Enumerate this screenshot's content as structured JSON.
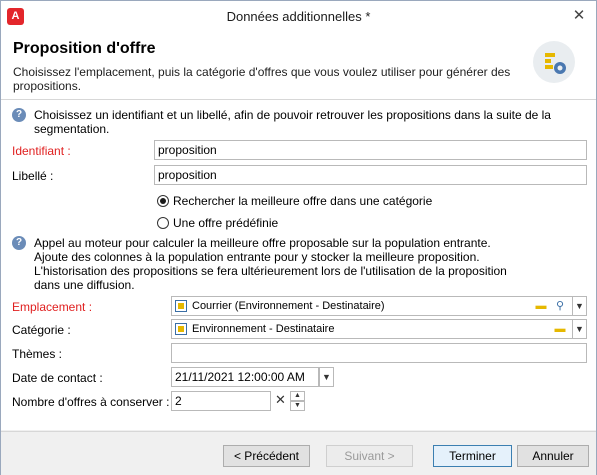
{
  "window": {
    "title": "Données additionnelles *"
  },
  "header": {
    "title": "Proposition d'offre",
    "description": "Choisissez l'emplacement, puis la catégorie d'offres que vous voulez utiliser pour générer des propositions."
  },
  "info1": "Choisissez un identifiant et un libellé, afin de pouvoir retrouver les propositions dans la suite de la segmentation.",
  "form": {
    "identifiant_label": "Identifiant :",
    "identifiant_value": "proposition",
    "libelle_label": "Libellé :",
    "libelle_value": "proposition",
    "radio_best": "Rechercher la meilleure offre dans une catégorie",
    "radio_predef": "Une offre prédéfinie",
    "info2_lines": [
      "Appel au moteur pour calculer la meilleure offre proposable sur la population entrante.",
      "Ajoute des colonnes à la population entrante pour y stocker la meilleure proposition.",
      "L'historisation des propositions se fera ultérieurement lors de l'utilisation de la proposition",
      "dans une diffusion."
    ],
    "emplacement_label": "Emplacement :",
    "emplacement_value": "Courrier (Environnement - Destinataire)",
    "categorie_label": "Catégorie :",
    "categorie_value": "Environnement - Destinataire",
    "themes_label": "Thèmes :",
    "themes_value": "",
    "date_label": "Date de contact :",
    "date_value": "21/11/2021 12:00:00 AM",
    "nombre_label": "Nombre d'offres à conserver :",
    "nombre_value": "2"
  },
  "footer": {
    "prev": "< Précédent",
    "next": "Suivant >",
    "finish": "Terminer",
    "cancel": "Annuler"
  },
  "colors": {
    "required": "#e02020",
    "brand": "#e3262b",
    "info": "#6b8cb8"
  }
}
